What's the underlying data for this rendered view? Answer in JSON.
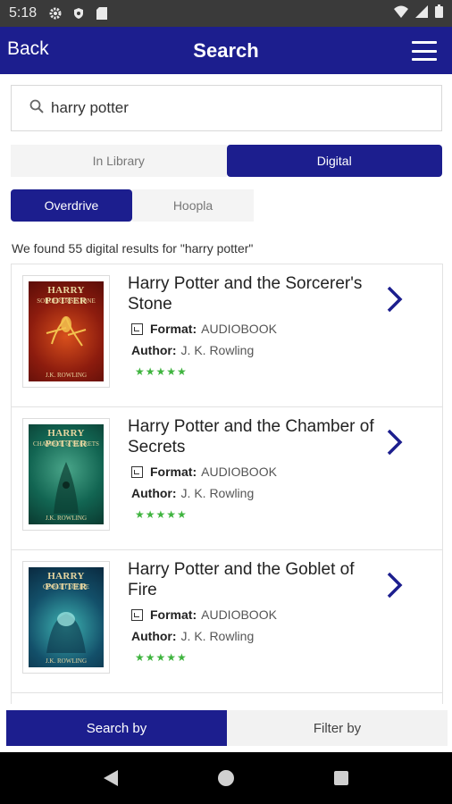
{
  "status_bar": {
    "time": "5:18"
  },
  "header": {
    "back_label": "Back",
    "title": "Search"
  },
  "search": {
    "query": "harry potter",
    "placeholder": ""
  },
  "location_tabs": {
    "in_library": "In Library",
    "digital": "Digital",
    "selected": "Digital"
  },
  "source_tabs": {
    "overdrive": "Overdrive",
    "hoopla": "Hoopla",
    "selected": "Overdrive"
  },
  "results_count": "We found 55 digital results for \"harry potter\"",
  "results": [
    {
      "title": "Harry Potter and the Sorcerer's Stone",
      "format_label": "Format:",
      "format": "AUDIOBOOK",
      "author_label": "Author:",
      "author": "J. K. Rowling",
      "rating_stars": "★★★★★",
      "cover_title": "HARRY POTTER",
      "cover_subtitle": "SORCERER'S STONE",
      "cover_author": "J.K. ROWLING"
    },
    {
      "title": "Harry Potter and the Chamber of Secrets",
      "format_label": "Format:",
      "format": "AUDIOBOOK",
      "author_label": "Author:",
      "author": "J. K. Rowling",
      "rating_stars": "★★★★★",
      "cover_title": "HARRY POTTER",
      "cover_subtitle": "CHAMBER of SECRETS",
      "cover_author": "J.K. ROWLING"
    },
    {
      "title": "Harry Potter and the Goblet of Fire",
      "format_label": "Format:",
      "format": "AUDIOBOOK",
      "author_label": "Author:",
      "author": "J. K. Rowling",
      "rating_stars": "★★★★★",
      "cover_title": "HARRY POTTER",
      "cover_subtitle": "GOBLET of FIRE",
      "cover_author": "J.K. ROWLING"
    }
  ],
  "bottom_tabs": {
    "search_by": "Search by",
    "filter_by": "Filter by",
    "selected": "Search by"
  },
  "colors": {
    "primary": "#1c1e8e",
    "star": "#3fb43f",
    "status_bar": "#3a3a3a"
  },
  "icons": {
    "status": [
      "gear-icon",
      "shield-icon",
      "sd-card-icon",
      "wifi-icon",
      "signal-icon",
      "battery-icon"
    ],
    "header": [
      "hamburger-menu-icon"
    ],
    "search": "search-icon",
    "result": [
      "audiobook-format-icon",
      "chevron-right-icon"
    ],
    "nav": [
      "back-triangle-icon",
      "home-circle-icon",
      "recents-square-icon"
    ]
  }
}
